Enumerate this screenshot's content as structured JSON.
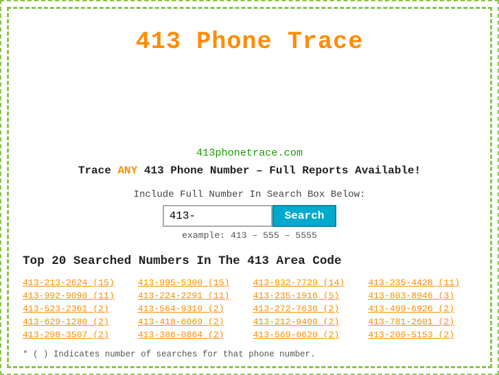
{
  "title": "413 Phone Trace",
  "site_url": "413phonetrace.com",
  "tagline_prefix": "Trace ",
  "tagline_any": "ANY",
  "tagline_suffix": " 413 Phone Number – Full Reports Available!",
  "search": {
    "label": "Include Full Number In Search Box Below:",
    "input_value": "413-",
    "button_label": "Search",
    "example": "example: 413 – 555 – 5555"
  },
  "top_numbers_title": "Top 20 Searched Numbers In The 413 Area Code",
  "numbers": [
    {
      "display": "413-213-2624 (15)"
    },
    {
      "display": "413-995-5300 (15)"
    },
    {
      "display": "413-832-7729 (14)"
    },
    {
      "display": "413-235-4428 (11)"
    },
    {
      "display": "413-992-9090 (11)"
    },
    {
      "display": "413-224-2291 (11)"
    },
    {
      "display": "413-235-1916 (5)"
    },
    {
      "display": "413-803-8946 (3)"
    },
    {
      "display": "413-523-2361 (2)"
    },
    {
      "display": "413-564-9310 (2)"
    },
    {
      "display": "413-272-7636 (2)"
    },
    {
      "display": "413-499-6926 (2)"
    },
    {
      "display": "413-629-1280 (2)"
    },
    {
      "display": "413-418-6069 (2)"
    },
    {
      "display": "413-212-9400 (2)"
    },
    {
      "display": "413-781-2601 (2)"
    },
    {
      "display": "413-298-3507 (2)"
    },
    {
      "display": "413-386-0864 (2)"
    },
    {
      "display": "413-569-0620 (2)"
    },
    {
      "display": "413-209-5153 (2)"
    }
  ],
  "footnote": "* ( ) Indicates number of searches for that phone number."
}
